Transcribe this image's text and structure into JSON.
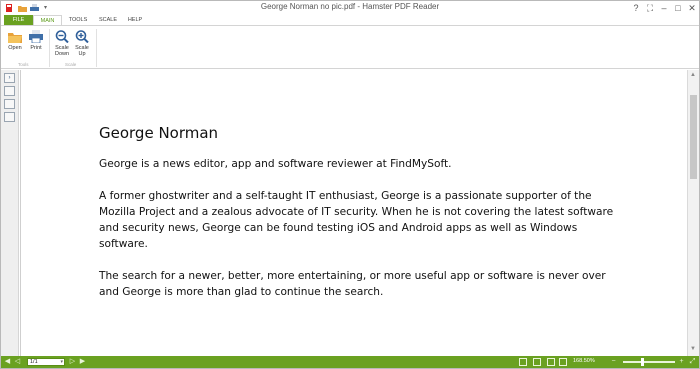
{
  "window": {
    "title": "George Norman no pic.pdf - Hamster PDF Reader"
  },
  "quick_access": [
    {
      "icon": "app-logo-icon"
    },
    {
      "icon": "folder-icon"
    },
    {
      "icon": "print-icon"
    },
    {
      "icon": "customize-arrow-icon"
    }
  ],
  "ribbon": {
    "tabs": [
      "FILE",
      "MAIN",
      "TOOLS",
      "SCALE",
      "HELP"
    ],
    "active_tab": "MAIN",
    "groups": {
      "tools": {
        "label": "Tools",
        "open": "Open",
        "print": "Print"
      },
      "scale": {
        "label": "Scale",
        "scale_down": "Scale\nDown",
        "scale_up": "Scale\nUp"
      }
    }
  },
  "document": {
    "heading": "George Norman",
    "paragraphs": [
      "George is a news editor, app and software reviewer at FindMySoft.",
      "A former ghostwriter and a self-taught IT enthusiast, George is a passionate supporter of the Mozilla Project and a zealous advocate of IT security. When he is not covering the latest software and security news, George can be found testing iOS and Android apps as well as Windows software.",
      "The search for a newer, better, more entertaining, or more useful app or software is never over and George is more than glad to continue the search."
    ]
  },
  "statusbar": {
    "page": "1/1",
    "zoom": "168.50%"
  },
  "colors": {
    "accent": "#6aa121",
    "text": "#111111"
  }
}
